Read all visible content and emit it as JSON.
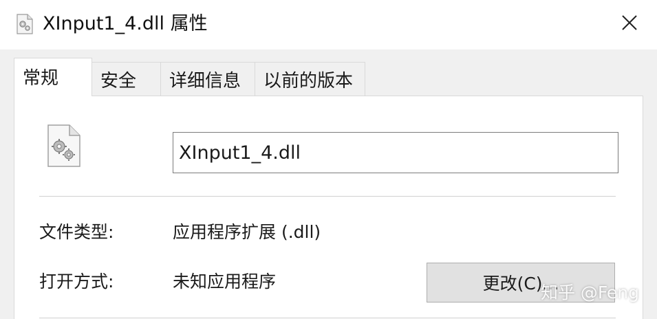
{
  "window": {
    "title": "XInput1_4.dll 属性"
  },
  "icons": {
    "title_icon": "dll-file-gear-icon",
    "close": "close-icon",
    "file": "dll-file-gear-icon"
  },
  "tabs": [
    {
      "label": "常规",
      "active": true
    },
    {
      "label": "安全",
      "active": false
    },
    {
      "label": "详细信息",
      "active": false
    },
    {
      "label": "以前的版本",
      "active": false
    }
  ],
  "general": {
    "file_name_value": "XInput1_4.dll",
    "file_type_label": "文件类型:",
    "file_type_value": "应用程序扩展 (.dll)",
    "open_with_label": "打开方式:",
    "open_with_value": "未知应用程序",
    "change_button_label": "更改(C)..."
  },
  "watermark": {
    "text": "知乎 @Feng"
  },
  "colors": {
    "tab_bg": "#f0f0f0",
    "panel_bg": "#ffffff",
    "border": "#d9d9d9",
    "button_bg": "#e1e1e1"
  }
}
